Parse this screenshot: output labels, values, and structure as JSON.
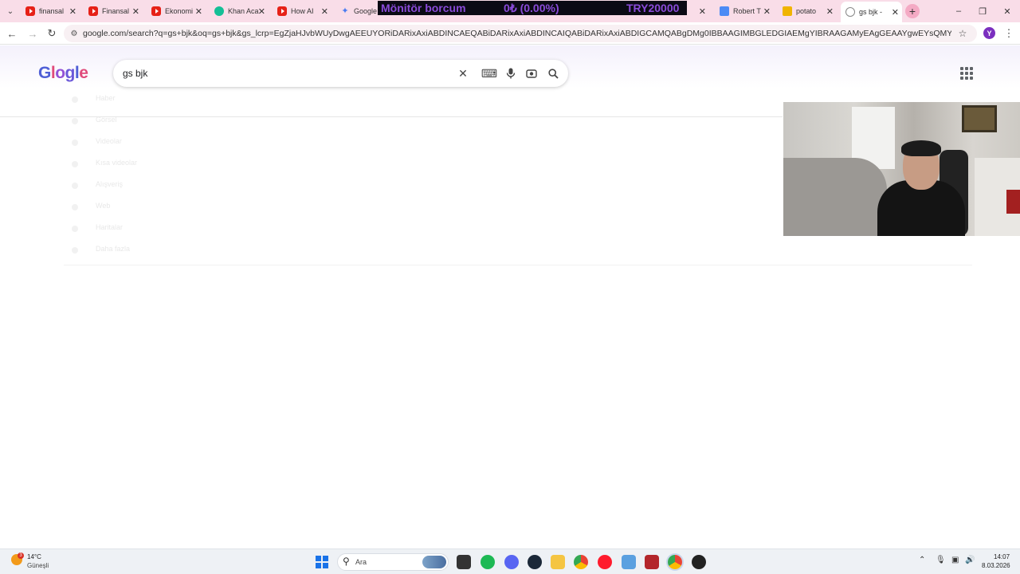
{
  "tabs": [
    {
      "title": "finansal",
      "favicon": "youtube-icon",
      "active": false
    },
    {
      "title": "Finansal",
      "favicon": "youtube-icon",
      "active": false
    },
    {
      "title": "Ekonomi",
      "favicon": "youtube-icon",
      "active": false
    },
    {
      "title": "Khan Aca",
      "favicon": "khan-academy-icon",
      "active": false
    },
    {
      "title": "How AI",
      "favicon": "youtube-icon",
      "active": false
    },
    {
      "title": "Google",
      "favicon": "gemini-icon",
      "active": false
    },
    {
      "title": "Robert T",
      "favicon": "google-sheets-icon",
      "active": false
    },
    {
      "title": "potato",
      "favicon": "potato-icon",
      "active": false
    },
    {
      "title": "gs bjk -",
      "favicon": "globe-icon",
      "active": true
    }
  ],
  "ticker": {
    "label": "Mönitör borcum",
    "change": "0₺ (0.00%)",
    "amount": "TRY20000",
    "color": "#8a4bd9"
  },
  "address_bar": {
    "url": "google.com/search?q=gs+bjk&oq=gs+bjk&gs_lcrp=EgZjaHJvbWUyDwgAEEUYORiDARixAxiABDINCAEQABiDARixAxiABDINCAIQABiDARixAxiABDIGCAMQABgDMg0IBBAAGIMBGLEDGIAEMgYIBRAAGAMyEAgGEAAYgwEYsQMYgAQYigUyDQgHEAAYgwEYsQMYgAQy...",
    "profile_initial": "Y"
  },
  "search": {
    "logo_text": "Google",
    "query": "gs bjk"
  },
  "faint_results": [
    "Haber",
    "Görsel",
    "Videolar",
    "Kısa videolar",
    "Alışveriş",
    "Web",
    "Haritalar",
    "Daha fazla"
  ],
  "taskbar": {
    "weather_temp": "14°C",
    "weather_condition": "Güneşli",
    "weather_badge": "3",
    "search_placeholder": "Ara",
    "time": "14:07",
    "date": "8.03.2026"
  }
}
